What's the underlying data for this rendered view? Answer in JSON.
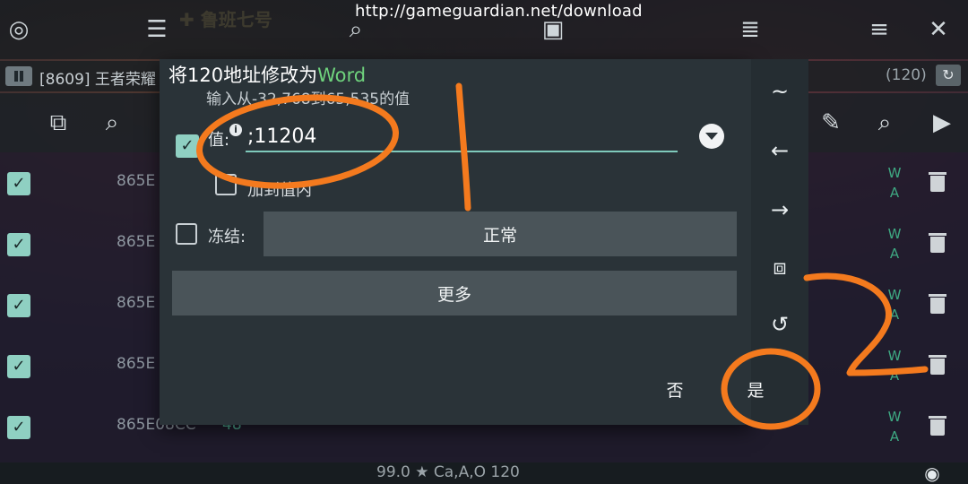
{
  "overlay": {
    "url": "http://gameguardian.net/download"
  },
  "topbar": {
    "icons": [
      "app-logo-icon",
      "sliders-icon",
      "search-icon",
      "save-icon",
      "list-icon",
      "menu-icon",
      "close-icon"
    ]
  },
  "process": {
    "label": "[8609] 王者荣耀",
    "count": "(120)"
  },
  "toolbar2": {
    "icons": [
      "select-copy-icon",
      "search-check-icon",
      "edit-icon",
      "search-icon",
      "play-icon"
    ]
  },
  "list": {
    "rows": [
      {
        "address": "865E",
        "type": "W\nA"
      },
      {
        "address": "865E",
        "type": "W\nA"
      },
      {
        "address": "865E",
        "type": "W\nA"
      },
      {
        "address": "865E",
        "type": "W\nA"
      },
      {
        "address": "865E08CC",
        "value": "48",
        "type": "W\nA"
      }
    ]
  },
  "status": {
    "text": "99.0 ★ Ca,A,O 120"
  },
  "dialog": {
    "title_prefix": "将120地址修改为",
    "title_type": "Word",
    "hint": "输入从-32,768到65,535的值",
    "value_label": "值:",
    "value": ";11204",
    "add_to_value_label": "加到值内",
    "freeze_label": "冻结:",
    "normal_button": "正常",
    "more_button": "更多",
    "no_button": "否",
    "yes_button": "是"
  },
  "side_panel": {
    "tilde": "~",
    "left_arrow": "←",
    "right_arrow": "→",
    "select_all": "⧈",
    "history": "↺"
  },
  "colors": {
    "accent_green": "#6fd37d",
    "check_teal": "#8fd0c2",
    "annotation_orange": "#f47a1e"
  }
}
